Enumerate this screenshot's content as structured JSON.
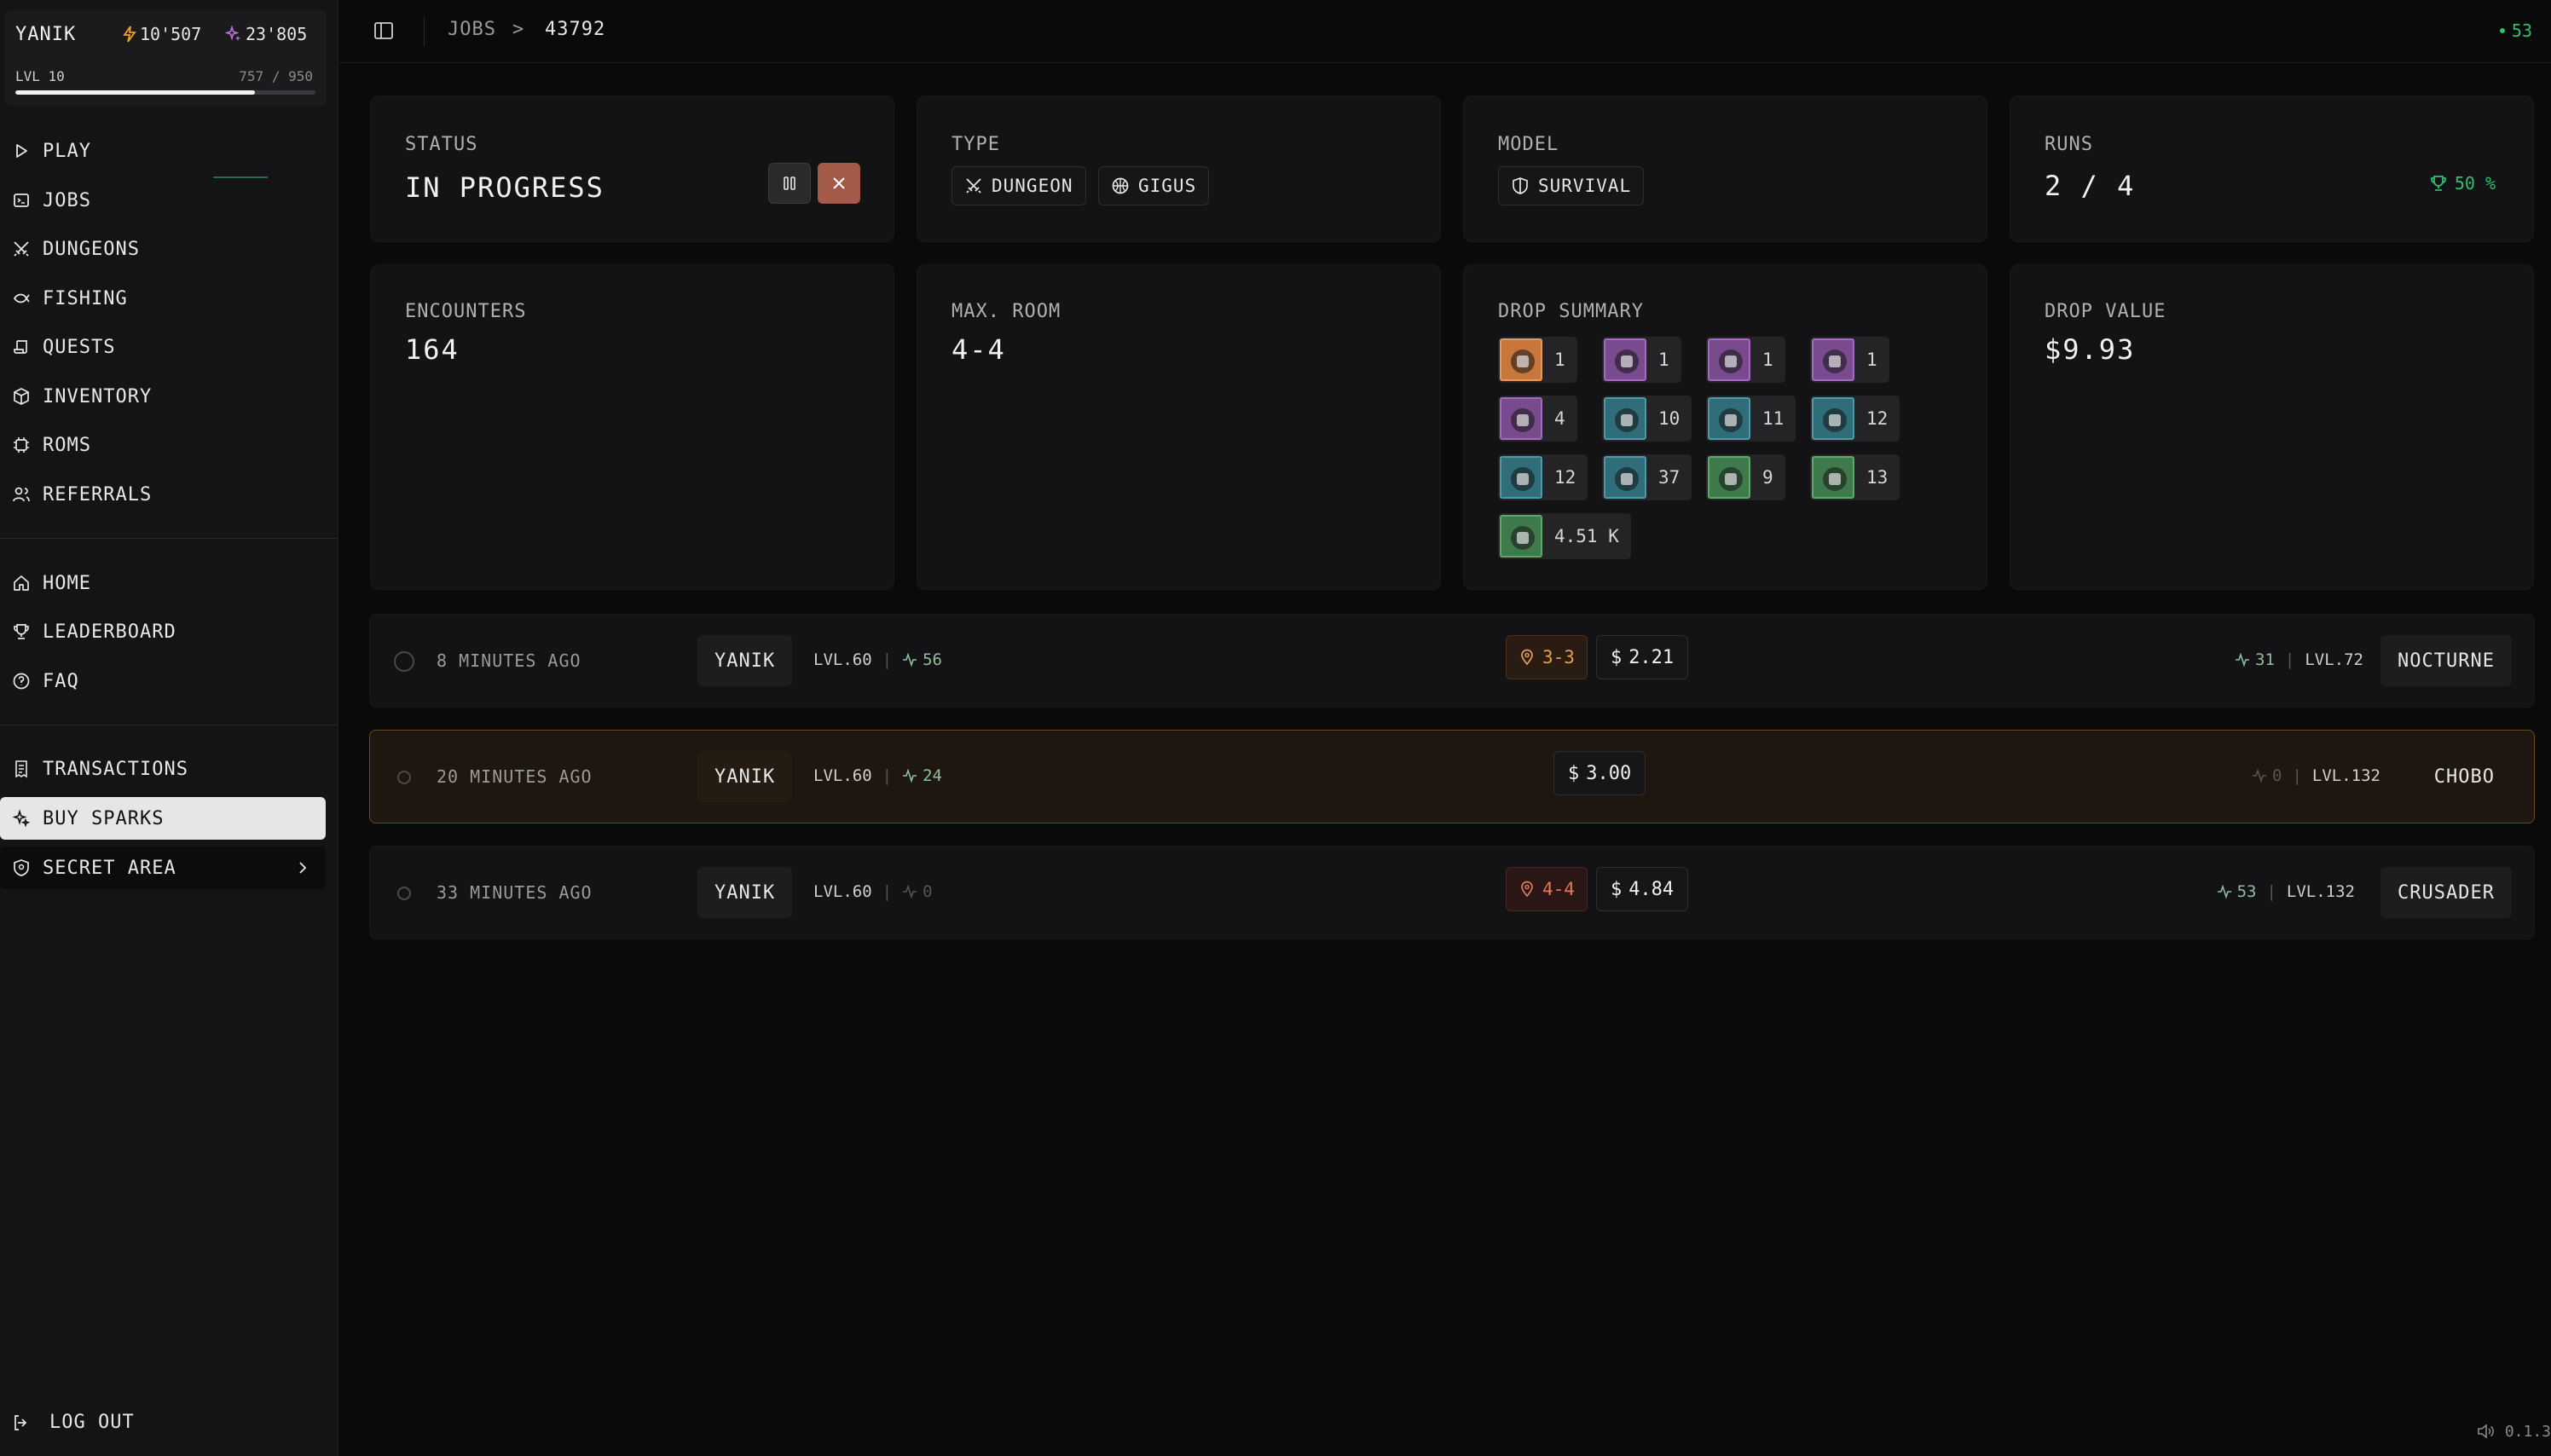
{
  "user": {
    "name": "YANIK",
    "sparks": "10'507",
    "gems": "23'805",
    "level": "LVL 10",
    "xp": "757 / 950",
    "xp_progress": 0.797
  },
  "nav": {
    "primary": [
      {
        "label": "PLAY",
        "icon": "play-icon"
      },
      {
        "label": "JOBS",
        "icon": "terminal-icon"
      },
      {
        "label": "DUNGEONS",
        "icon": "swords-icon"
      },
      {
        "label": "FISHING",
        "icon": "fish-icon"
      },
      {
        "label": "QUESTS",
        "icon": "scroll-icon"
      },
      {
        "label": "INVENTORY",
        "icon": "box-icon"
      },
      {
        "label": "ROMS",
        "icon": "chip-icon"
      },
      {
        "label": "REFERRALS",
        "icon": "users-icon"
      }
    ],
    "secondary": [
      {
        "label": "HOME",
        "icon": "home-icon"
      },
      {
        "label": "LEADERBOARD",
        "icon": "trophy-icon"
      },
      {
        "label": "FAQ",
        "icon": "help-icon"
      }
    ],
    "tertiary": [
      {
        "label": "TRANSACTIONS",
        "icon": "receipt-icon"
      },
      {
        "label": "BUY SPARKS",
        "icon": "sparkles-icon"
      },
      {
        "label": "SECRET AREA",
        "icon": "shield-icon"
      }
    ],
    "logout": "LOG OUT"
  },
  "breadcrumb": {
    "section": "JOBS",
    "separator": ">",
    "id": "43792"
  },
  "online": {
    "count": "53"
  },
  "status": {
    "label": "STATUS",
    "value": "IN PROGRESS"
  },
  "type": {
    "label": "TYPE",
    "tags": [
      "DUNGEON",
      "GIGUS"
    ]
  },
  "model": {
    "label": "MODEL",
    "value": "SURVIVAL"
  },
  "runs": {
    "label": "RUNS",
    "value": "2 / 4",
    "win_rate": "50 %"
  },
  "encounters": {
    "label": "ENCOUNTERS",
    "value": "164"
  },
  "max_room": {
    "label": "MAX. ROOM",
    "value": "4-4"
  },
  "drop_summary": {
    "label": "DROP SUMMARY",
    "items": [
      {
        "count": "1",
        "rarity": "orange"
      },
      {
        "count": "1",
        "rarity": "purple"
      },
      {
        "count": "1",
        "rarity": "purple"
      },
      {
        "count": "1",
        "rarity": "purple"
      },
      {
        "count": "4",
        "rarity": "purple"
      },
      {
        "count": "10",
        "rarity": "teal"
      },
      {
        "count": "11",
        "rarity": "teal"
      },
      {
        "count": "12",
        "rarity": "teal"
      },
      {
        "count": "12",
        "rarity": "teal"
      },
      {
        "count": "37",
        "rarity": "teal"
      },
      {
        "count": "9",
        "rarity": "green"
      },
      {
        "count": "13",
        "rarity": "green"
      },
      {
        "count": "4.51 K",
        "rarity": "green"
      }
    ]
  },
  "drop_value": {
    "label": "DROP VALUE",
    "value": "$9.93"
  },
  "runs_list": [
    {
      "time": "8 MINUTES AGO",
      "player": "YANIK",
      "level": "LVL.60",
      "power": "56",
      "room": "3-3",
      "room_color": "orange",
      "value": "2.21",
      "opp_power": "31",
      "opp_level": "LVL.72",
      "opponent": "NOCTURNE"
    },
    {
      "time": "20 MINUTES AGO",
      "player": "YANIK",
      "level": "LVL.60",
      "power": "24",
      "room": "",
      "room_color": "",
      "value": "3.00",
      "opp_power": "0",
      "opp_level": "LVL.132",
      "opponent": "CHOBO"
    },
    {
      "time": "33 MINUTES AGO",
      "player": "YANIK",
      "level": "LVL.60",
      "power": "0",
      "room": "4-4",
      "room_color": "red",
      "value": "4.84",
      "opp_power": "53",
      "opp_level": "LVL.132",
      "opponent": "CRUSADER"
    }
  ],
  "version": "0.1.3",
  "colors": {
    "accent_green": "#2fbf6f",
    "sparks": "#f0a030",
    "gems": "#c070e0",
    "cancel": "#a45a48"
  }
}
